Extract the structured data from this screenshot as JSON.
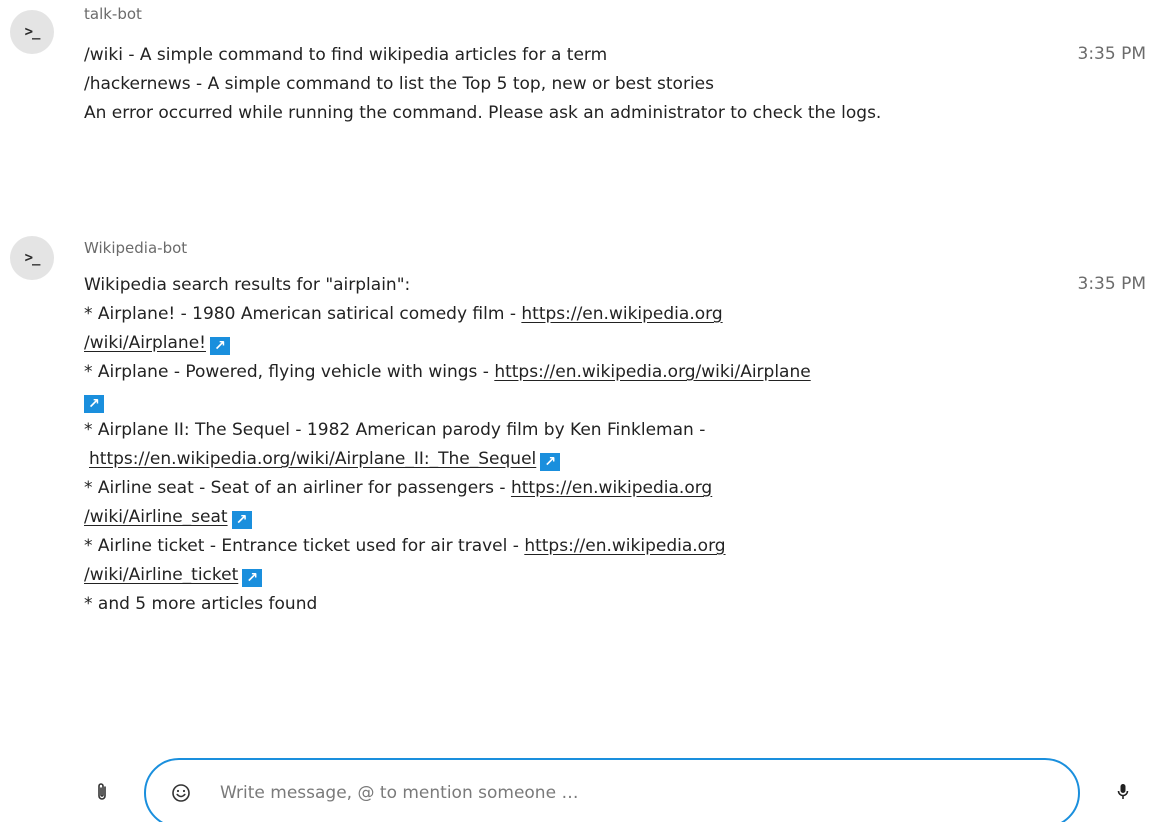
{
  "messages": [
    {
      "author": "talk-bot",
      "avatar_text": ">_",
      "time": "3:35 PM",
      "lines": [
        "/wiki - A simple command to find wikipedia articles for a term",
        "/hackernews - A simple command to list the Top 5 top, new or best stories",
        "An error occurred while running the command. Please ask an administrator to check the logs."
      ]
    },
    {
      "author": "Wikipedia-bot",
      "avatar_text": ">_",
      "time": "3:35 PM",
      "intro": "Wikipedia search results for \"airplain\":",
      "results": [
        {
          "text": "* Airplane! - 1980 American satirical comedy film - ",
          "url_part1": "https://en.wikipedia.org",
          "url_part2": "/wiki/Airplane!"
        },
        {
          "text": "* Airplane - Powered, flying vehicle with wings - ",
          "url_part1": "https://en.wikipedia.org/wiki/Airplane",
          "url_part2": ""
        },
        {
          "text": "* Airplane II: The Sequel - 1982 American parody film by Ken Finkleman - ",
          "url_part1": "",
          "url_part2": "https://en.wikipedia.org/wiki/Airplane_II:_The_Sequel"
        },
        {
          "text": "* Airline seat - Seat of an airliner for passengers - ",
          "url_part1": "https://en.wikipedia.org",
          "url_part2": "/wiki/Airline_seat"
        },
        {
          "text": "* Airline ticket - Entrance ticket used for air travel - ",
          "url_part1": "https://en.wikipedia.org",
          "url_part2": "/wiki/Airline_ticket"
        }
      ],
      "footer": "* and 5 more articles found"
    }
  ],
  "composer": {
    "placeholder": "Write message, @ to mention someone …"
  },
  "icons": {
    "external_link": "↗"
  },
  "colors": {
    "accent": "#1a8fdd"
  }
}
